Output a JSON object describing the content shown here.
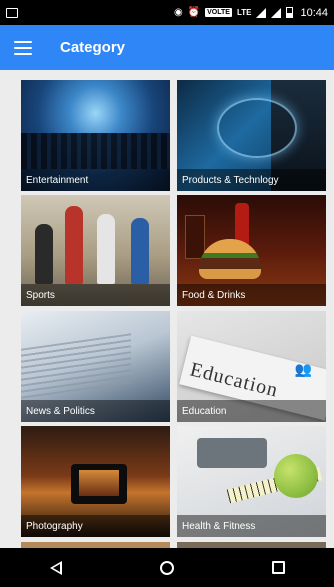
{
  "status_bar": {
    "volte": "VOLTE",
    "lte": "LTE",
    "time": "10:44",
    "icons": [
      "screenshot-icon",
      "nfc-icon",
      "alarm-icon",
      "volte-icon",
      "lte-icon",
      "signal-icon",
      "signal-icon",
      "battery-icon"
    ]
  },
  "app_bar": {
    "title": "Category",
    "menu_icon": "hamburger-menu-icon",
    "accent_color": "#2f86f6"
  },
  "categories": [
    {
      "label": "Entertainment"
    },
    {
      "label": "Products & Technlogy"
    },
    {
      "label": "Sports"
    },
    {
      "label": "Food & Drinks"
    },
    {
      "label": "News & Politics"
    },
    {
      "label": "Education",
      "image_text": "Education"
    },
    {
      "label": "Photography"
    },
    {
      "label": "Health & Fitness"
    }
  ],
  "nav_bar": {
    "icons": [
      "back-icon",
      "home-icon",
      "recent-apps-icon"
    ]
  }
}
